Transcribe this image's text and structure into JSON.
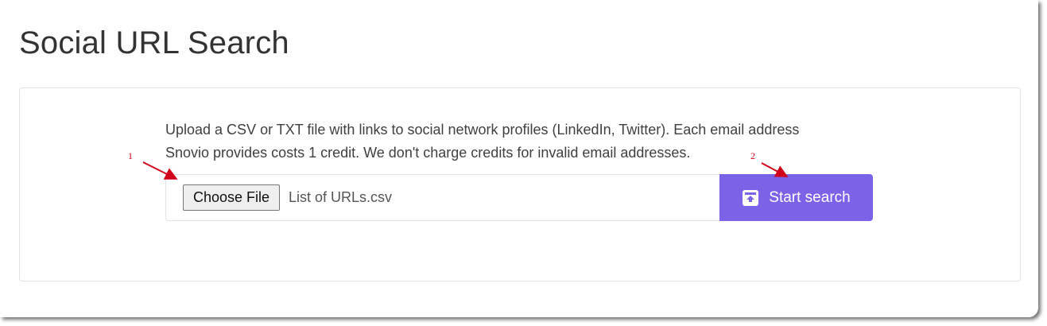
{
  "page": {
    "title": "Social URL Search"
  },
  "upload": {
    "description_line1": "Upload a CSV or TXT file with links to social network profiles (LinkedIn, Twitter). Each email address",
    "description_line2": "Snovio provides costs 1 credit. We don't charge credits for invalid email addresses.",
    "choose_file_label": "Choose File",
    "file_name": "List of URLs.csv",
    "start_search_label": "Start search",
    "start_search_icon": "upload-box-icon"
  },
  "annotations": {
    "marker_1": "1",
    "marker_2": "2"
  },
  "colors": {
    "accent": "#7b63e8",
    "annotation": "#d0021b",
    "title_text": "#333333"
  }
}
